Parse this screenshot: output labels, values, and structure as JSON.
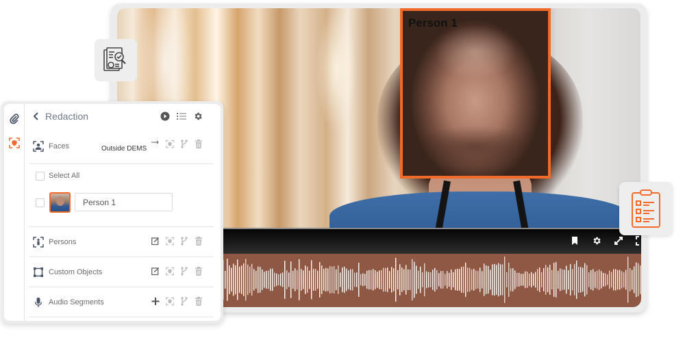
{
  "video": {
    "detection_label": "Person 1",
    "accent_color": "#f26a2a",
    "controls": {
      "bookmark_icon": "bookmark-icon",
      "settings_icon": "gear-icon",
      "expand_icon": "expand-icon",
      "fullscreen_icon": "fullscreen-icon"
    },
    "waveform_color": "#8f5844"
  },
  "floating_tiles": [
    {
      "icon": "document-search-icon"
    },
    {
      "icon": "clipboard-checklist-icon"
    }
  ],
  "panel": {
    "rail": [
      {
        "icon": "paperclip-icon",
        "active": false
      },
      {
        "icon": "redaction-shield-icon",
        "active": true
      }
    ],
    "header": {
      "back_icon": "chevron-left-icon",
      "title": "Redaction",
      "actions": [
        "play-icon",
        "list-icon",
        "gear-icon"
      ]
    },
    "sections": [
      {
        "label": "Faces",
        "icon": "face-detect-icon",
        "sublabel": "Outside DEMS",
        "actions": [
          "arrow-right-icon",
          "redact-icon",
          "merge-icon",
          "trash-icon"
        ]
      }
    ],
    "faces": {
      "select_all_label": "Select All",
      "select_all_checked": false,
      "items": [
        {
          "name": "Person 1",
          "checked": false
        }
      ]
    },
    "other_sections": [
      {
        "label": "Persons",
        "icon": "person-detect-icon",
        "actions": [
          "edit-icon",
          "redact-icon",
          "merge-icon",
          "trash-icon"
        ]
      },
      {
        "label": "Custom Objects",
        "icon": "bounding-box-icon",
        "actions": [
          "edit-icon",
          "redact-icon",
          "merge-icon",
          "trash-icon"
        ]
      },
      {
        "label": "Audio Segments",
        "icon": "microphone-icon",
        "actions": [
          "plus-icon",
          "redact-icon",
          "merge-icon",
          "trash-icon"
        ]
      }
    ]
  }
}
